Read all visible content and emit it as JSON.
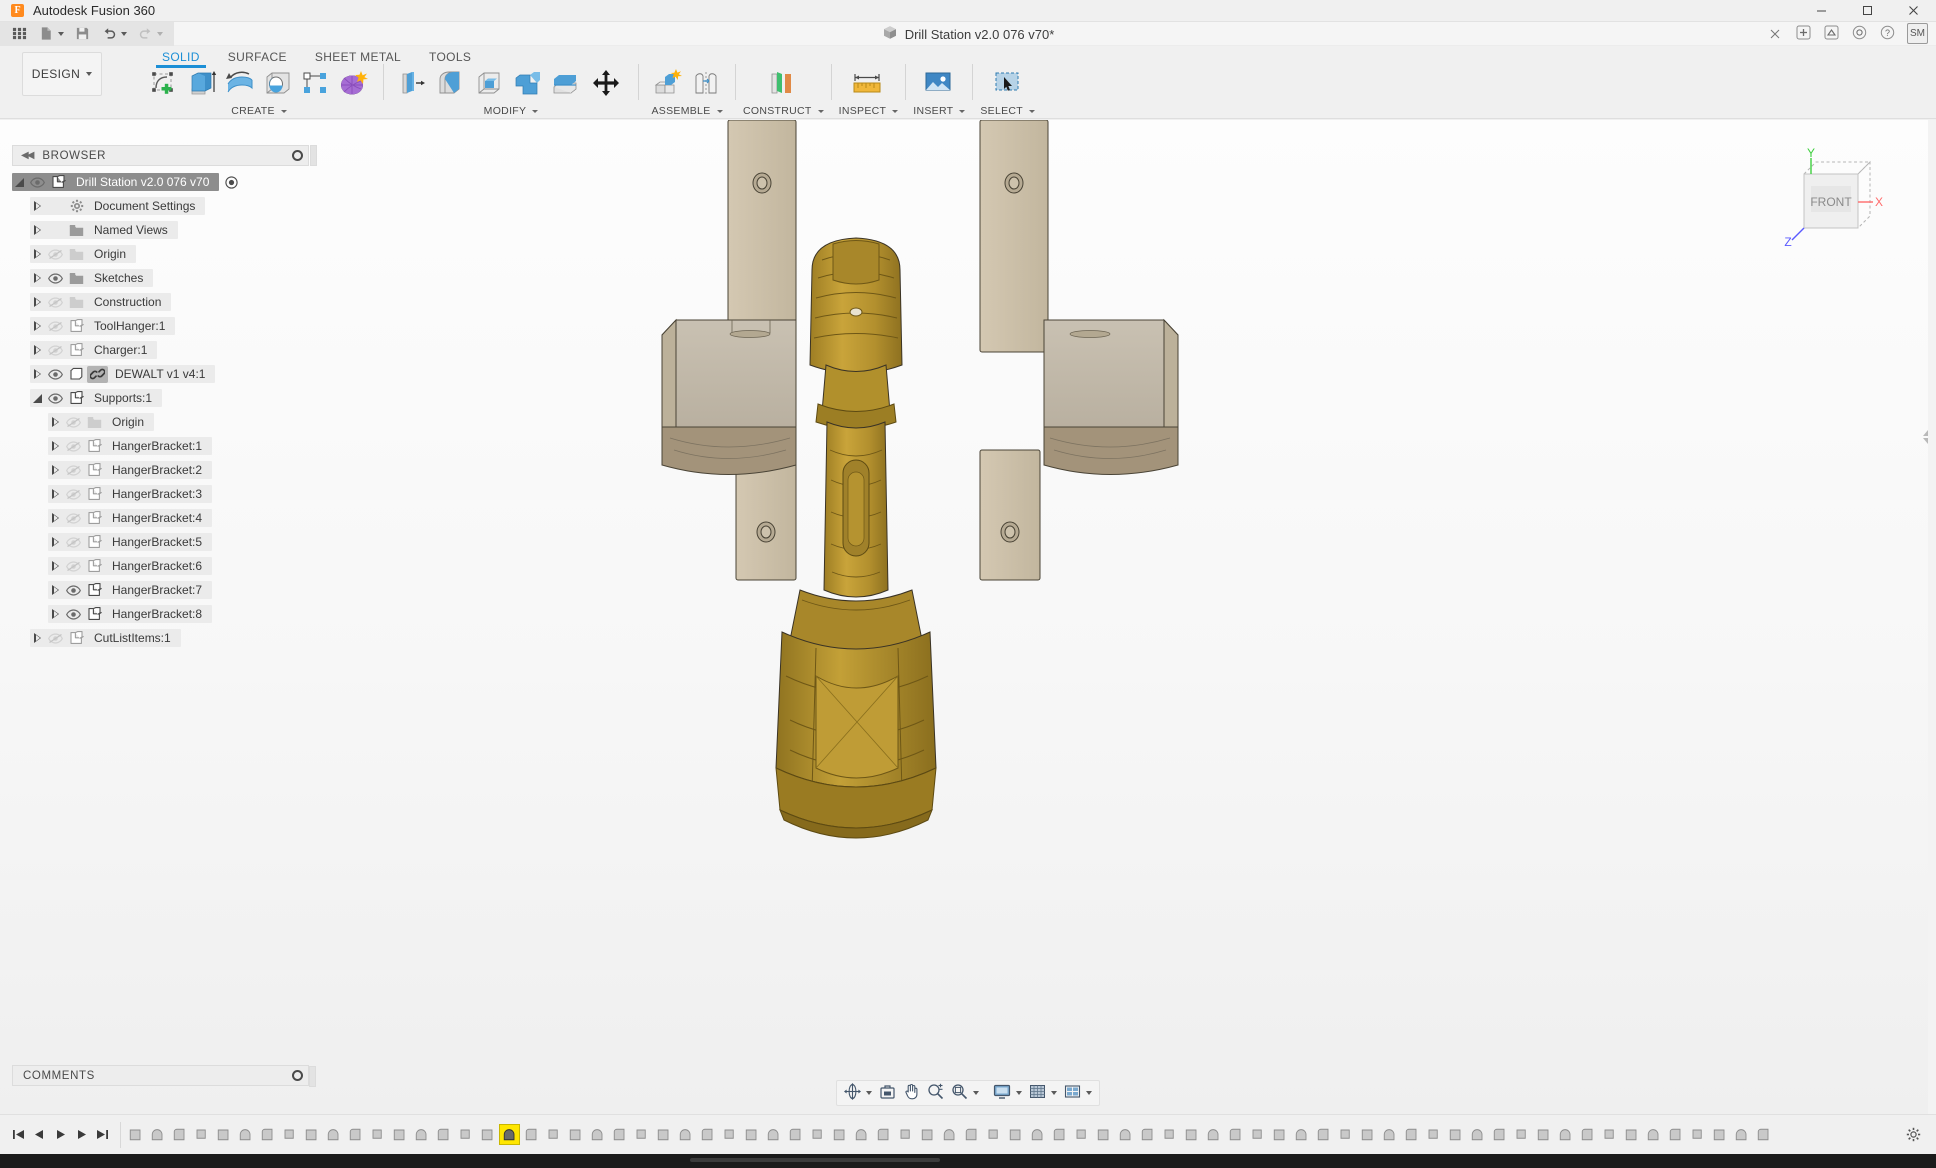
{
  "window": {
    "app_title": "Autodesk Fusion 360",
    "app_logo_letter": "F",
    "minimize": "─",
    "maximize": "☐",
    "close": "✕"
  },
  "quick_access": {
    "grid_icon": "grid-apps-icon",
    "new_icon": "new-document-icon",
    "save_icon": "save-icon",
    "undo_icon": "undo-icon",
    "redo_icon": "redo-icon",
    "document_name": "Drill Station v2.0 076 v70*",
    "document_close": "✕",
    "right_icons": [
      "add-icon",
      "extensions-icon",
      "notifications-icon",
      "help-icon"
    ],
    "avatar_initials": "SM"
  },
  "ribbon": {
    "design_label": "DESIGN",
    "tabs": [
      {
        "label": "SOLID",
        "active": true
      },
      {
        "label": "SURFACE",
        "active": false
      },
      {
        "label": "SHEET METAL",
        "active": false
      },
      {
        "label": "TOOLS",
        "active": false
      }
    ],
    "panels": [
      {
        "label": "CREATE",
        "has_caret": true,
        "tools": [
          "create-sketch-icon",
          "extrude-icon",
          "revolve-icon",
          "sphere-icon",
          "pattern-icon",
          "form-icon"
        ]
      },
      {
        "label": "MODIFY",
        "has_caret": true,
        "tools": [
          "press-pull-icon",
          "fillet-icon",
          "shell-icon",
          "combine-icon",
          "offset-face-icon",
          "move-copy-icon"
        ]
      },
      {
        "label": "ASSEMBLE",
        "has_caret": true,
        "tools": [
          "new-component-icon",
          "joint-icon"
        ]
      },
      {
        "label": "CONSTRUCT",
        "has_caret": true,
        "tools": [
          "offset-plane-icon"
        ]
      },
      {
        "label": "INSPECT",
        "has_caret": true,
        "tools": [
          "measure-icon"
        ]
      },
      {
        "label": "INSERT",
        "has_caret": true,
        "tools": [
          "insert-mcmaster-icon"
        ]
      },
      {
        "label": "SELECT",
        "has_caret": true,
        "tools": [
          "select-icon"
        ]
      }
    ]
  },
  "browser": {
    "header_title": "BROWSER",
    "collapse_icon": "double-left-arrow-icon",
    "options_icon": "radio-dot-icon",
    "tree": [
      {
        "label": "Drill Station v2.0 076 v70",
        "depth": 0,
        "state": "open",
        "eye": "visible",
        "icon": "component-icon",
        "selected": true,
        "trailing_icon": "radio-dot-icon"
      },
      {
        "label": "Document Settings",
        "depth": 1,
        "state": "closed",
        "eye": "none",
        "icon": "gear-icon",
        "selected": false
      },
      {
        "label": "Named Views",
        "depth": 1,
        "state": "closed",
        "eye": "none",
        "icon": "folder-icon",
        "selected": false
      },
      {
        "label": "Origin",
        "depth": 1,
        "state": "closed",
        "eye": "hidden",
        "icon": "folder-icon",
        "selected": false
      },
      {
        "label": "Sketches",
        "depth": 1,
        "state": "closed",
        "eye": "visible",
        "icon": "folder-icon",
        "selected": false
      },
      {
        "label": "Construction",
        "depth": 1,
        "state": "closed",
        "eye": "hidden",
        "icon": "folder-icon",
        "selected": false
      },
      {
        "label": "ToolHanger:1",
        "depth": 1,
        "state": "closed",
        "eye": "hidden",
        "icon": "component-icon",
        "selected": false
      },
      {
        "label": "Charger:1",
        "depth": 1,
        "state": "closed",
        "eye": "hidden",
        "icon": "component-icon",
        "selected": false
      },
      {
        "label": "DEWALT v1 v4:1",
        "depth": 1,
        "state": "closed",
        "eye": "visible",
        "icon": "body-icon",
        "link_icon": "link-icon",
        "selected": false
      },
      {
        "label": "Supports:1",
        "depth": 1,
        "state": "open",
        "eye": "visible",
        "icon": "component-icon",
        "selected": false
      },
      {
        "label": "Origin",
        "depth": 2,
        "state": "closed",
        "eye": "hidden",
        "icon": "folder-icon",
        "selected": false
      },
      {
        "label": "HangerBracket:1",
        "depth": 2,
        "state": "closed",
        "eye": "hidden",
        "icon": "component-icon",
        "selected": false
      },
      {
        "label": "HangerBracket:2",
        "depth": 2,
        "state": "closed",
        "eye": "hidden",
        "icon": "component-icon",
        "selected": false
      },
      {
        "label": "HangerBracket:3",
        "depth": 2,
        "state": "closed",
        "eye": "hidden",
        "icon": "component-icon",
        "selected": false
      },
      {
        "label": "HangerBracket:4",
        "depth": 2,
        "state": "closed",
        "eye": "hidden",
        "icon": "component-icon",
        "selected": false
      },
      {
        "label": "HangerBracket:5",
        "depth": 2,
        "state": "closed",
        "eye": "hidden",
        "icon": "component-icon",
        "selected": false
      },
      {
        "label": "HangerBracket:6",
        "depth": 2,
        "state": "closed",
        "eye": "hidden",
        "icon": "component-icon",
        "selected": false
      },
      {
        "label": "HangerBracket:7",
        "depth": 2,
        "state": "closed",
        "eye": "visible",
        "icon": "component-icon",
        "selected": false
      },
      {
        "label": "HangerBracket:8",
        "depth": 2,
        "state": "closed",
        "eye": "visible",
        "icon": "component-icon",
        "selected": false
      },
      {
        "label": "CutListItems:1",
        "depth": 1,
        "state": "closed",
        "eye": "hidden",
        "icon": "component-icon",
        "selected": false
      }
    ]
  },
  "comments": {
    "title": "COMMENTS",
    "options_icon": "radio-dot-icon"
  },
  "viewcube": {
    "face_label": "FRONT",
    "axis_x": "X",
    "axis_y": "Y",
    "axis_z": "Z",
    "color_x": "#ff6b6b",
    "color_y": "#3ecf3e",
    "color_z": "#5a5aff"
  },
  "navbar": {
    "items": [
      {
        "name": "orbit-icon",
        "caret": true
      },
      {
        "name": "look-at-icon",
        "caret": false
      },
      {
        "name": "pan-hand-icon",
        "caret": false
      },
      {
        "name": "zoom-icon",
        "caret": false
      },
      {
        "name": "zoom-window-icon",
        "caret": true
      },
      {
        "name": "display-settings-icon",
        "caret": true
      },
      {
        "name": "grid-snaps-icon",
        "caret": true
      },
      {
        "name": "viewports-icon",
        "caret": true
      }
    ]
  },
  "timeline": {
    "playback": [
      "skip-to-start-icon",
      "step-back-icon",
      "play-icon",
      "step-forward-icon",
      "skip-to-end-icon"
    ],
    "active_feature_index": 17,
    "feature_count": 75,
    "settings_icon": "gear-icon"
  },
  "model": {
    "description": "3D front view of a cordless drill mounted on a wooden wall hanger station",
    "colors": {
      "drill_body": "#b8932f",
      "drill_shade": "#8d6f21",
      "wood_light": "#cfc3ad",
      "wood_mid": "#b5a890",
      "wood_dark": "#9a8a6e",
      "edge": "#3a3325"
    }
  }
}
